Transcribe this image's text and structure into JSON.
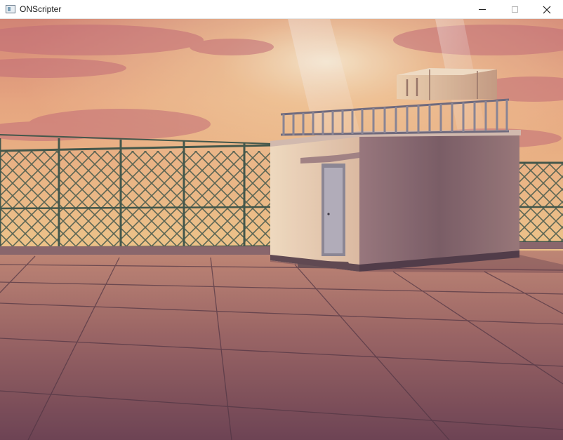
{
  "window": {
    "title": "ONScripter",
    "icon": "app-window-icon",
    "controls": [
      "minimize-icon",
      "maximize-icon",
      "close-icon"
    ]
  },
  "scene": {
    "sky_colors": [
      "#e8a27c",
      "#f0b386",
      "#f6c98a"
    ],
    "floor_colors": [
      "#b57e72",
      "#8b5a5e",
      "#6e4556"
    ]
  }
}
